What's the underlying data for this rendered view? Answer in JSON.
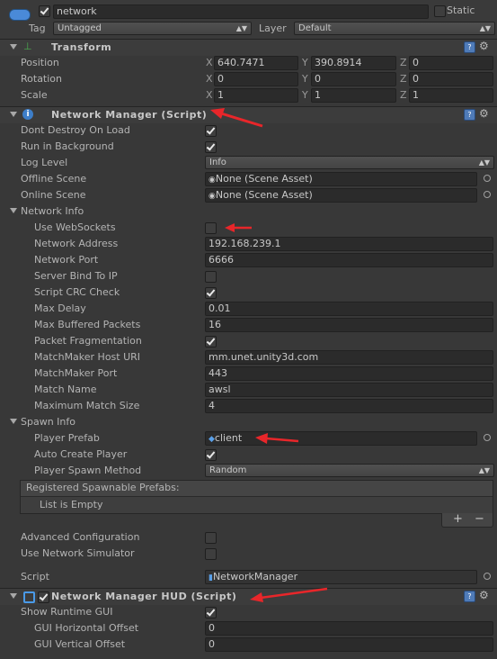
{
  "object": {
    "name": "network",
    "static_label": "Static",
    "tag_label": "Tag",
    "tag_value": "Untagged",
    "layer_label": "Layer",
    "layer_value": "Default"
  },
  "transform": {
    "title": "Transform",
    "position_label": "Position",
    "rotation_label": "Rotation",
    "scale_label": "Scale",
    "axis_x": "X",
    "axis_y": "Y",
    "axis_z": "Z",
    "position": [
      "640.7471",
      "390.8914",
      "0"
    ],
    "rotation": [
      "0",
      "0",
      "0"
    ],
    "scale": [
      "1",
      "1",
      "1"
    ]
  },
  "network_manager": {
    "title": "Network Manager (Script)",
    "dont_destroy_label": "Dont Destroy On Load",
    "run_in_background_label": "Run in Background",
    "log_level_label": "Log Level",
    "log_level_value": "Info",
    "offline_scene_label": "Offline Scene",
    "offline_scene_value": "None (Scene Asset)",
    "online_scene_label": "Online Scene",
    "online_scene_value": "None (Scene Asset)",
    "network_info_label": "Network Info",
    "use_websockets_label": "Use WebSockets",
    "network_address_label": "Network Address",
    "network_address_value": "192.168.239.1",
    "network_port_label": "Network Port",
    "network_port_value": "6666",
    "server_bind_label": "Server Bind To IP",
    "script_crc_label": "Script CRC Check",
    "max_delay_label": "Max Delay",
    "max_delay_value": "0.01",
    "max_buffered_label": "Max Buffered Packets",
    "max_buffered_value": "16",
    "packet_frag_label": "Packet Fragmentation",
    "mm_host_label": "MatchMaker Host URI",
    "mm_host_value": "mm.unet.unity3d.com",
    "mm_port_label": "MatchMaker Port",
    "mm_port_value": "443",
    "match_name_label": "Match Name",
    "match_name_value": "awsl",
    "max_match_label": "Maximum Match Size",
    "max_match_value": "4",
    "spawn_info_label": "Spawn Info",
    "player_prefab_label": "Player Prefab",
    "player_prefab_value": "client",
    "auto_create_label": "Auto Create Player",
    "spawn_method_label": "Player Spawn Method",
    "spawn_method_value": "Random",
    "registered_label": "Registered Spawnable Prefabs:",
    "list_empty_label": "List is Empty",
    "add_label": "+",
    "remove_label": "−",
    "advanced_label": "Advanced Configuration",
    "simulator_label": "Use Network Simulator",
    "script_label": "Script",
    "script_value": "NetworkManager"
  },
  "hud": {
    "title": "Network Manager HUD (Script)",
    "show_gui_label": "Show Runtime GUI",
    "h_offset_label": "GUI Horizontal Offset",
    "h_offset_value": "0",
    "v_offset_label": "GUI Vertical Offset",
    "v_offset_value": "0"
  },
  "colors": {
    "background": "#383838",
    "field": "#2b2b2b",
    "annotation_arrow": "#e8262a"
  }
}
